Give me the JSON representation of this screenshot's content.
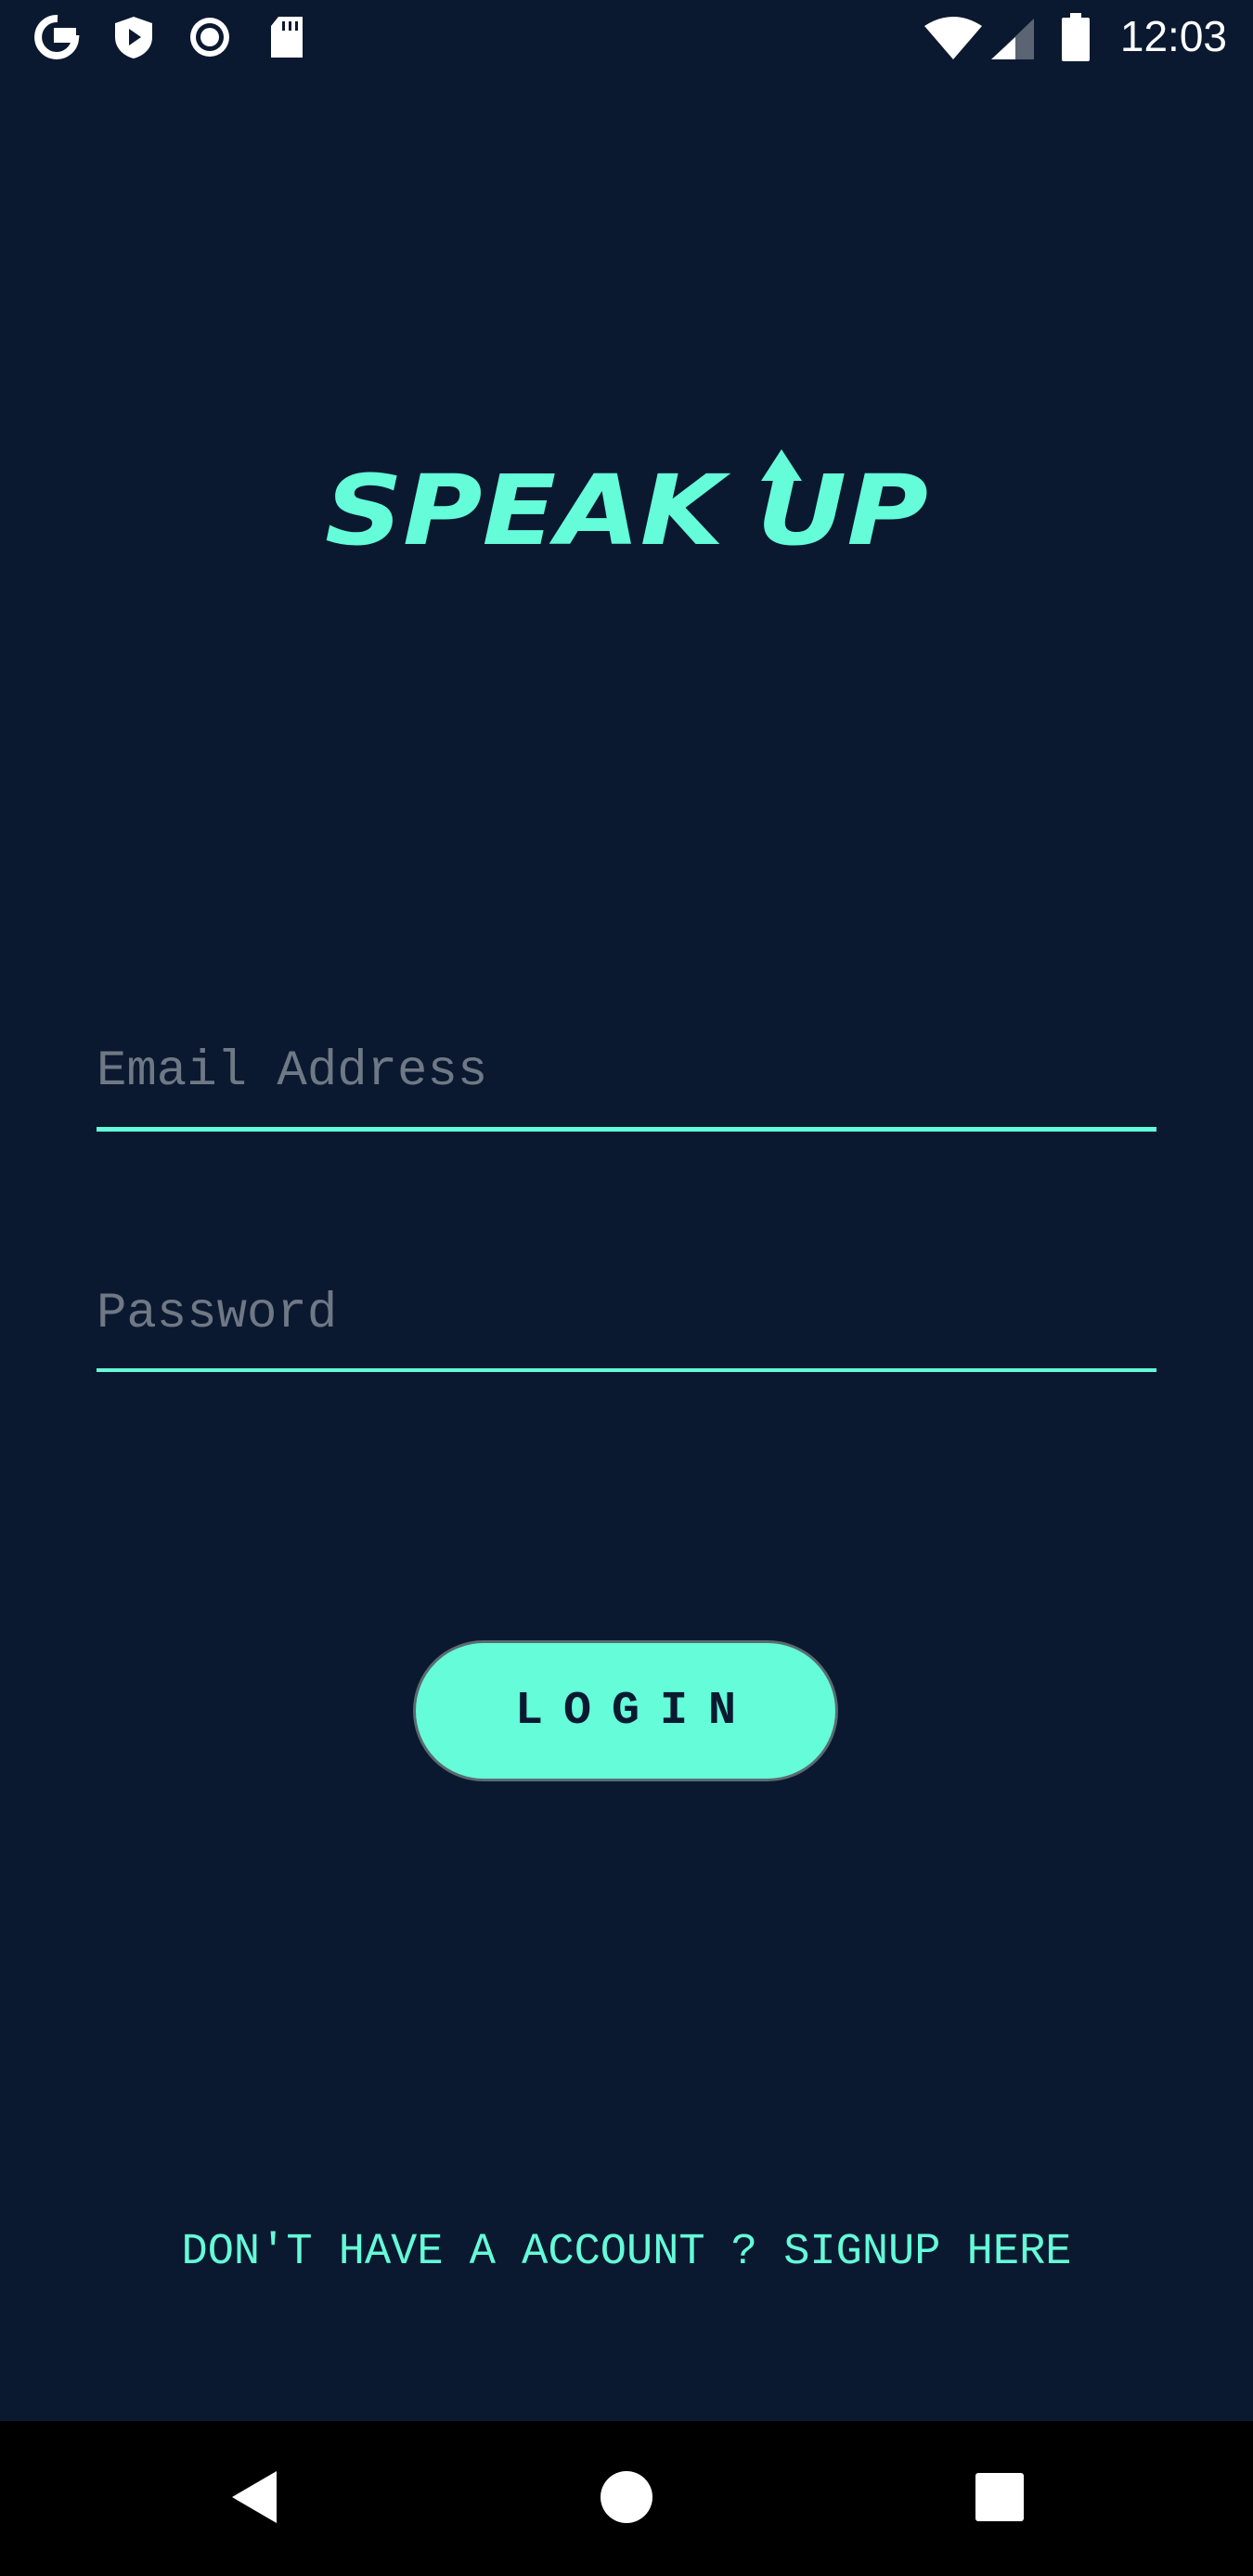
{
  "status_bar": {
    "time": "12:03",
    "left_icons": [
      "google-icon",
      "play-protect-icon",
      "record-icon",
      "sd-card-icon"
    ],
    "right_icons": [
      "wifi-icon",
      "cell-signal-icon",
      "battery-icon"
    ]
  },
  "app": {
    "logo_text": "SPEAK UP",
    "accent_color": "#64fcd9",
    "background_color": "#0b1930"
  },
  "form": {
    "email_placeholder": "Email Address",
    "password_placeholder": "Password",
    "login_label": "LOGIN",
    "signup_text": "DON'T HAVE A ACCOUNT ? SIGNUP HERE"
  },
  "nav_bar": {
    "buttons": [
      "back-icon",
      "home-icon",
      "recents-icon"
    ]
  }
}
